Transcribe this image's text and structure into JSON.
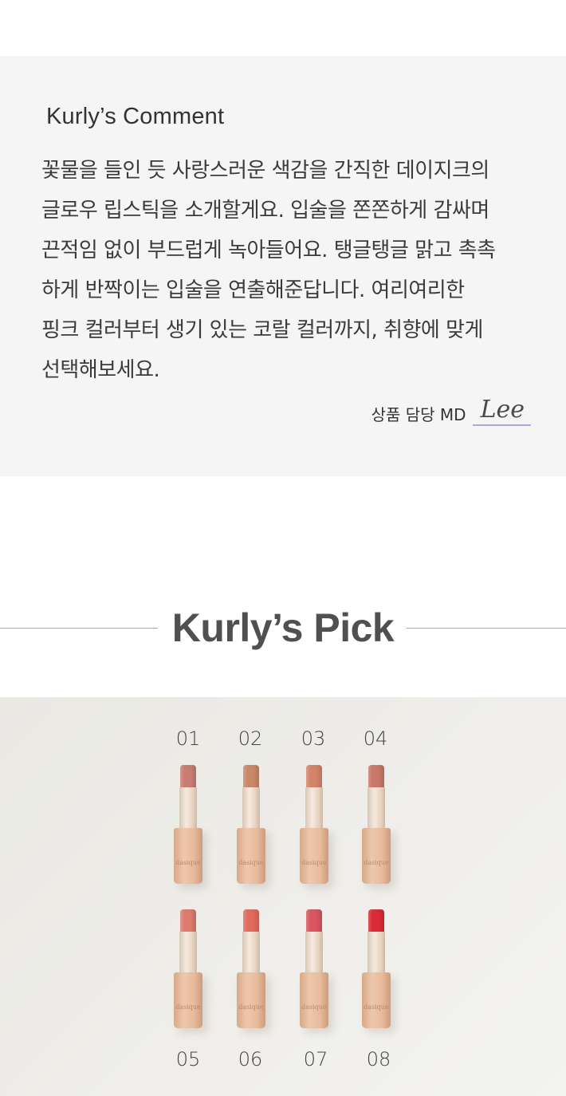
{
  "comment": {
    "title": "Kurly’s Comment",
    "body": "꽃물을 들인 듯 사랑스러운 색감을 간직한 데이지크의\n글로우 립스틱을 소개할게요. 입술을 쫀쫀하게 감싸며\n끈적임 없이 부드럽게 녹아들어요. 탱글탱글 맑고 촉촉\n하게 반짝이는 입술을 연출해준답니다. 여리여리한\n핑크 컬러부터 생기 있는 코랄 컬러까지, 취향에 맞게\n선택해보세요.",
    "signature_label": "상품 담당 MD",
    "signature_name": "Lee"
  },
  "pick": {
    "title": "Kurly’s Pick",
    "brand": "dasique",
    "shades": [
      {
        "number": "01",
        "color": "#c87d72"
      },
      {
        "number": "02",
        "color": "#c98868"
      },
      {
        "number": "03",
        "color": "#d4846a"
      },
      {
        "number": "04",
        "color": "#c97868"
      },
      {
        "number": "05",
        "color": "#dc7c6e"
      },
      {
        "number": "06",
        "color": "#df6c5e"
      },
      {
        "number": "07",
        "color": "#d95660"
      },
      {
        "number": "08",
        "color": "#d92c36"
      }
    ]
  }
}
